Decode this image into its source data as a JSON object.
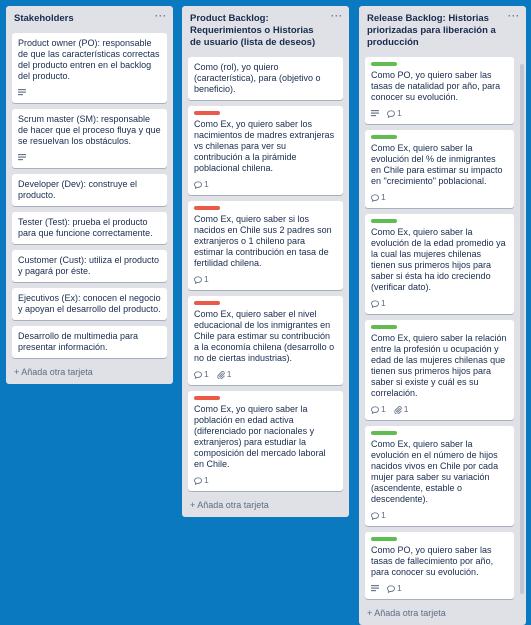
{
  "lists": [
    {
      "title": "Stakeholders",
      "menu": "···",
      "cards": [
        {
          "text": "Product owner (PO): responsable de que las características correctas del producto entren en el backlog del producto.",
          "desc": true
        },
        {
          "text": "Scrum master (SM): responsable de hacer que el proceso fluya y que se resuelvan los obstáculos.",
          "desc": true
        },
        {
          "text": "Developer (Dev): construye el producto."
        },
        {
          "text": "Tester (Test): prueba el producto para que funcione correctamente."
        },
        {
          "text": "Customer (Cust): utiliza el producto y pagará por éste."
        },
        {
          "text": "Ejecutivos (Ex): conocen el negocio y apoyan el desarrollo del producto."
        },
        {
          "text": "Desarrollo de multimedia para presentar información."
        }
      ],
      "add_card": "+ Añada otra tarjeta"
    },
    {
      "title": "Product Backlog: Requerimientos o Historias de usuario (lista de deseos)",
      "menu": "···",
      "cards": [
        {
          "text": "Como (rol), yo quiero (característica), para (objetivo o beneficio)."
        },
        {
          "label": "red",
          "text": "Como Ex, yo quiero saber los nacimientos de madres extranjeras vs chilenas para ver su contribución a la pirámide poblacional chilena.",
          "comments": "1"
        },
        {
          "label": "red",
          "text": "Como Ex, quiero saber si los nacidos en Chile sus 2 padres son extranjeros o 1 chileno para estimar la contribución en tasa de fertilidad chilena.",
          "comments": "1"
        },
        {
          "label": "red",
          "text": "Como Ex, quiero saber el nivel educacional de los inmigrantes en Chile para estimar su contribución a la economía chilena (desarrollo o no de ciertas industrias).",
          "comments": "1",
          "attachments": "1"
        },
        {
          "label": "red",
          "text": "Como Ex, yo quiero saber la población en edad activa (diferenciado por nacionales y extranjeros) para estudiar la composición del mercado laboral en Chile.",
          "comments": "1"
        }
      ],
      "add_card": "+ Añada otra tarjeta"
    },
    {
      "title": "Release Backlog: Historias priorizadas para liberación a producción",
      "menu": "···",
      "cards": [
        {
          "label": "green",
          "text": "Como PO, yo quiero saber las tasas de natalidad por año, para conocer su evolución.",
          "desc": true,
          "comments": "1"
        },
        {
          "label": "green",
          "text": "Como Ex, quiero saber la evolución del % de inmigrantes en Chile para estimar su impacto en \"crecimiento\" poblacional.",
          "comments": "1"
        },
        {
          "label": "green",
          "text": "Como Ex, quiero saber la evolución de la edad promedio ya la cual las mujeres chilenas tienen sus primeros hijos para saber si ésta ha ido creciendo (verificar dato).",
          "comments": "1"
        },
        {
          "label": "green",
          "text": "Como Ex, quiero saber la relación entre la profesión u ocupación y edad de las mujeres chilenas que tienen sus primeros hijos para saber si existe y cuál es su correlación.",
          "comments": "1",
          "attachments": "1"
        },
        {
          "label": "green",
          "text": "Como Ex, quiero saber la evolución en el número de hijos nacidos vivos en Chile por cada mujer para saber su variación (ascendente, estable o descendente).",
          "comments": "1"
        },
        {
          "label": "green",
          "text": "Como PO, yo quiero saber las tasas de fallecimiento por año, para conocer su evolución.",
          "desc": true,
          "comments": "1"
        }
      ],
      "add_card": "+ Añada otra tarjeta"
    }
  ],
  "colors": {
    "board_bg": "#0b79bf",
    "list_bg": "#dfe1e6",
    "label_red": "#eb5a46",
    "label_green": "#61bd4f"
  }
}
